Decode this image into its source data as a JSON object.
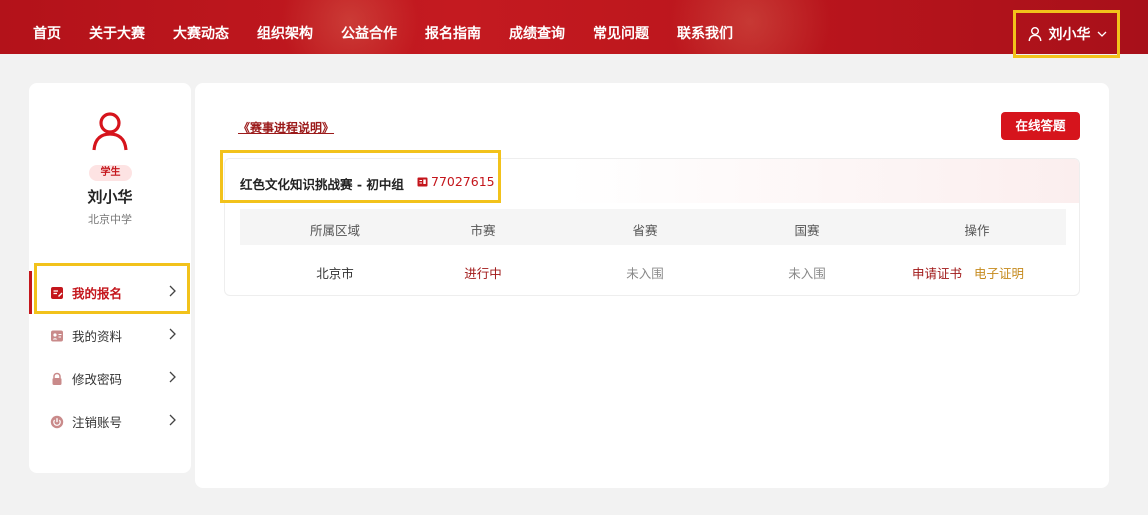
{
  "nav": {
    "items": [
      "首页",
      "关于大赛",
      "大赛动态",
      "组织架构",
      "公益合作",
      "报名指南",
      "成绩查询",
      "常见问题",
      "联系我们"
    ],
    "user_name": "刘小华"
  },
  "colors": {
    "brand": "#c4161c",
    "highlight": "#f2c21b",
    "accent_gold": "#c58a1c"
  },
  "profile": {
    "role": "学生",
    "name": "刘小华",
    "school": "北京中学"
  },
  "sidebar": {
    "items": [
      {
        "label": "我的报名",
        "icon": "registration-icon",
        "active": true
      },
      {
        "label": "我的资料",
        "icon": "profile-card-icon",
        "active": false
      },
      {
        "label": "修改密码",
        "icon": "lock-icon",
        "active": false
      },
      {
        "label": "注销账号",
        "icon": "power-icon",
        "active": false
      }
    ]
  },
  "main": {
    "process_link": "《赛事进程说明》",
    "answer_button": "在线答题",
    "contest": {
      "name": "红色文化知识挑战赛 - 初中组",
      "reg_number": "77027615"
    },
    "table": {
      "headers": [
        "所属区域",
        "市赛",
        "省赛",
        "国赛",
        "操作"
      ],
      "row": {
        "region": "北京市",
        "city": "进行中",
        "province": "未入围",
        "national": "未入围",
        "actions": [
          "申请证书",
          "电子证明"
        ]
      }
    }
  }
}
